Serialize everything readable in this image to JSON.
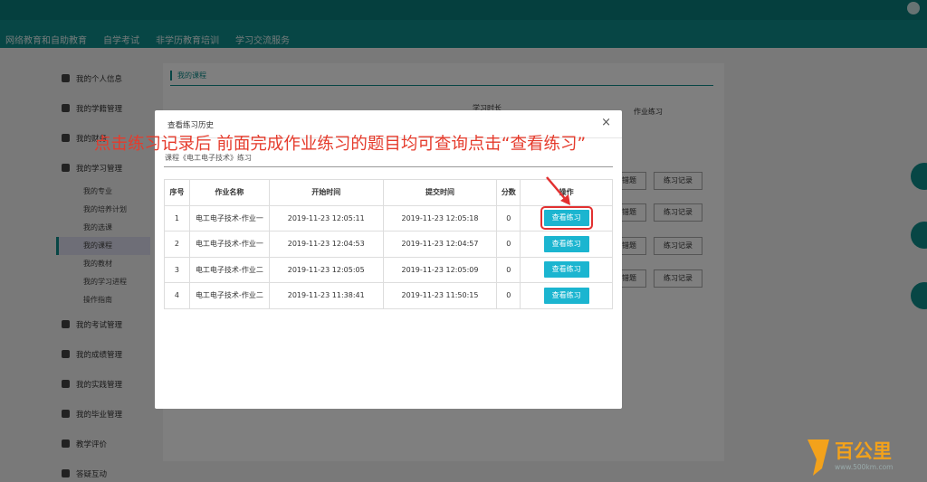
{
  "nav": {
    "items": [
      "网络教育和自助教育",
      "自学考试",
      "非学历教育培训",
      "学习交流服务"
    ]
  },
  "sidebar": {
    "items": [
      {
        "label": "我的个人信息"
      },
      {
        "label": "我的学籍管理"
      },
      {
        "label": "我的财务"
      },
      {
        "label": "我的学习管理"
      }
    ],
    "subitems": [
      "我的专业",
      "我的培养计划",
      "我的选课",
      "我的课程",
      "我的教材",
      "我的学习进程",
      "操作指南"
    ],
    "items_after": [
      {
        "label": "我的考试管理"
      },
      {
        "label": "我的成绩管理"
      },
      {
        "label": "我的实践管理"
      },
      {
        "label": "我的毕业管理"
      },
      {
        "label": "教学评价"
      },
      {
        "label": "答疑互动"
      }
    ]
  },
  "content": {
    "crumb": "我的课程",
    "head_study": "学习时长",
    "head_practice": "作业练习",
    "bg_buttons": [
      "查看错题",
      "练习记录"
    ]
  },
  "modal": {
    "title": "查看练习历史",
    "close": "×",
    "course": "课程《电工电子技术》练习",
    "columns": [
      "序号",
      "作业名称",
      "开始时间",
      "提交时间",
      "分数",
      "操作"
    ],
    "rows": [
      {
        "no": "1",
        "name": "电工电子技术-作业一",
        "start": "2019-11-23 12:05:11",
        "submit": "2019-11-23 12:05:18",
        "score": "0",
        "action": "查看练习"
      },
      {
        "no": "2",
        "name": "电工电子技术-作业一",
        "start": "2019-11-23 12:04:53",
        "submit": "2019-11-23 12:04:57",
        "score": "0",
        "action": "查看练习"
      },
      {
        "no": "3",
        "name": "电工电子技术-作业二",
        "start": "2019-11-23 12:05:05",
        "submit": "2019-11-23 12:05:09",
        "score": "0",
        "action": "查看练习"
      },
      {
        "no": "4",
        "name": "电工电子技术-作业二",
        "start": "2019-11-23 11:38:41",
        "submit": "2019-11-23 11:50:15",
        "score": "0",
        "action": "查看练习"
      }
    ]
  },
  "annotation": {
    "text": "点击练习记录后 前面完成作业练习的题目均可查询点击“查看练习”",
    "color": "#e53b2c"
  },
  "watermark": {
    "brand": "百公里",
    "url": "www.500km.com"
  },
  "colors": {
    "accent": "#0e8d8a",
    "button": "#1bb5d0",
    "highlight": "#e23030"
  }
}
